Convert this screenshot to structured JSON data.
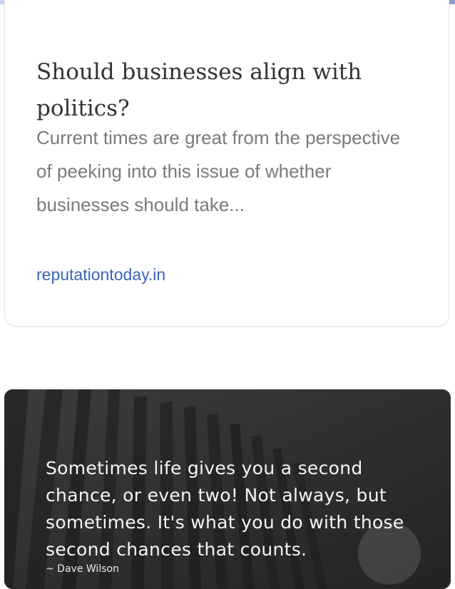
{
  "article": {
    "title": "Should businesses align with politics?",
    "snippet": "Current times are great from the perspective of peeking into this issue of whether businesses should take...",
    "source": "reputationtoday.in"
  },
  "quote": {
    "text": "Sometimes life gives you a second chance, or even two! Not always, but sometimes. It's what you do with those second chances that counts.",
    "author": "~ Dave Wilson"
  }
}
